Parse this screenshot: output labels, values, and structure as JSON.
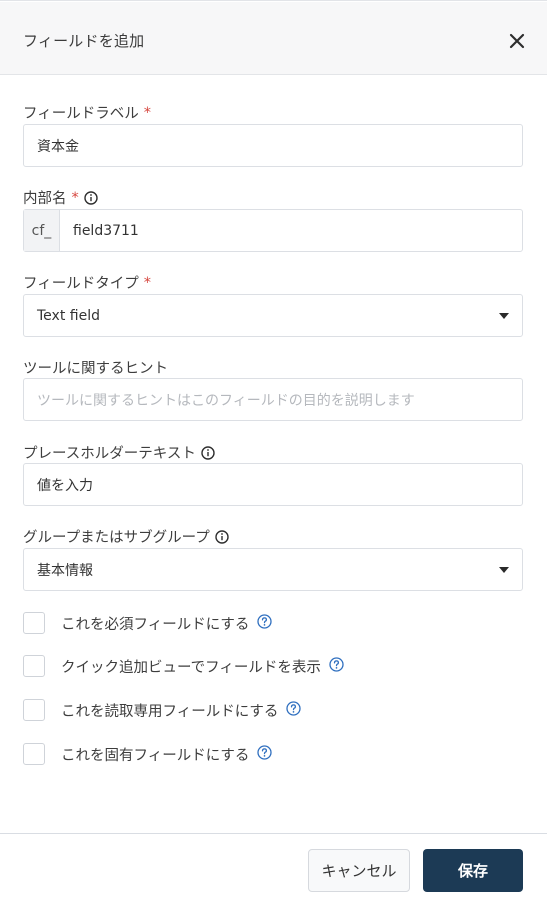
{
  "header": {
    "title": "フィールドを追加",
    "close_icon": "close-icon"
  },
  "fields": {
    "field_label": {
      "label": "フィールドラベル",
      "required_mark": "*",
      "value": "資本金"
    },
    "internal_name": {
      "label": "内部名",
      "required_mark": "*",
      "info_icon": "info-icon",
      "prefix": "cf_",
      "value": "field3711"
    },
    "field_type": {
      "label": "フィールドタイプ",
      "required_mark": "*",
      "selected": "Text field"
    },
    "tooltip_hint": {
      "label": "ツールに関するヒント",
      "placeholder": "ツールに関するヒントはこのフィールドの目的を説明します"
    },
    "placeholder_text": {
      "label": "プレースホルダーテキスト",
      "info_icon": "info-icon",
      "value": "値を入力"
    },
    "group": {
      "label": "グループまたはサブグループ",
      "info_icon": "info-icon",
      "selected": "基本情報"
    }
  },
  "checkboxes": [
    {
      "label": "これを必須フィールドにする",
      "checked": false
    },
    {
      "label": "クイック追加ビューでフィールドを表示",
      "checked": false
    },
    {
      "label": "これを読取専用フィールドにする",
      "checked": false
    },
    {
      "label": "これを固有フィールドにする",
      "checked": false
    }
  ],
  "footer": {
    "cancel_label": "キャンセル",
    "save_label": "保存"
  },
  "colors": {
    "required": "#d6453d",
    "primary": "#1c3a55",
    "help": "#2f6fbf"
  }
}
